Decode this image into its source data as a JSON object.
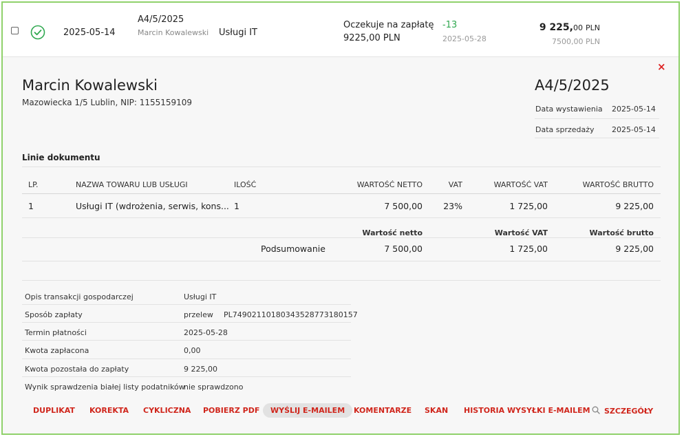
{
  "row": {
    "date": "2025-05-14",
    "doc_number": "A4/5/2025",
    "client": "Marcin Kowalewski",
    "category": "Usługi IT",
    "status": "Oczekuje na zapłatę",
    "status_amount": "9225,00 PLN",
    "days": "-13",
    "due_date": "2025-05-28",
    "gross_whole": "9 225,",
    "gross_cents": "00",
    "gross_currency": "PLN",
    "net_amount": "7500,00 PLN"
  },
  "detail": {
    "close": "×",
    "buyer_name": "Marcin Kowalewski",
    "buyer_address": "Mazowiecka 1/5 Lublin, NIP: 1155159109",
    "doc_title": "A4/5/2025",
    "issue_label": "Data wystawienia",
    "issue_date": "2025-05-14",
    "sale_label": "Data sprzedaży",
    "sale_date": "2025-05-14",
    "lines_title": "Linie dokumentu",
    "columns": {
      "lp": "LP.",
      "name": "NAZWA TOWARU LUB USŁUGI",
      "qty": "ILOŚĆ",
      "net": "WARTOŚĆ NETTO",
      "vat": "VAT",
      "vat_value": "WARTOŚĆ VAT",
      "gross": "WARTOŚĆ BRUTTO"
    },
    "lines": [
      {
        "lp": "1",
        "name": "Usługi IT (wdrożenia, serwis, kons...",
        "qty": "1",
        "net": "7 500,00",
        "vat": "23%",
        "vat_value": "1 725,00",
        "gross": "9 225,00"
      }
    ],
    "summary": {
      "net_label": "Wartość netto",
      "vat_label": "Wartość VAT",
      "gross_label": "Wartość brutto",
      "row_label": "Podsumowanie",
      "net": "7 500,00",
      "vat": "1 725,00",
      "gross": "9 225,00"
    },
    "info": [
      {
        "label": "Opis transakcji gospodarczej",
        "value": "Usługi IT",
        "extra": ""
      },
      {
        "label": "Sposób zapłaty",
        "value": "przelew",
        "extra": "PL74902110180343528773180157"
      },
      {
        "label": "Termin płatności",
        "value": "2025-05-28",
        "extra": ""
      },
      {
        "label": "Kwota zapłacona",
        "value": "0,00",
        "extra": ""
      },
      {
        "label": "Kwota pozostała do zapłaty",
        "value": "9 225,00",
        "extra": ""
      },
      {
        "label": "Wynik sprawdzenia białej listy podatników",
        "value": "nie sprawdzono",
        "extra": ""
      }
    ]
  },
  "actions": {
    "duplicate": "DUPLIKAT",
    "correction": "KOREKTA",
    "recurring": "CYKLICZNA",
    "download_pdf": "POBIERZ PDF",
    "send_email": "WYŚLIJ E-MAILEM",
    "comments": "KOMENTARZE",
    "scan": "SKAN",
    "email_history": "HISTORIA WYSYŁKI E-MAILEM",
    "details": "SZCZEGÓŁY"
  },
  "colors": {
    "accent": "#d0261c",
    "success": "#2fa84f",
    "frame": "#8fd16a"
  },
  "icons": {
    "status": "check-circle-icon",
    "details": "search-icon",
    "close": "close-icon"
  }
}
